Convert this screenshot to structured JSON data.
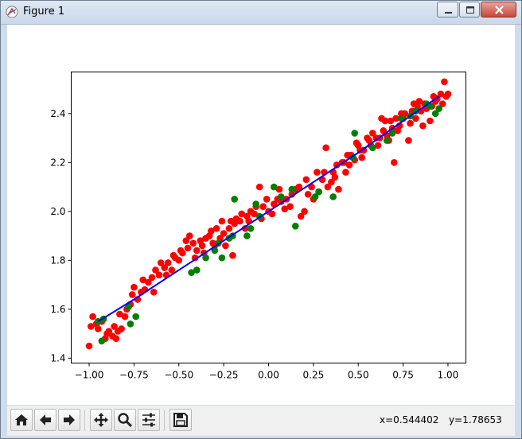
{
  "window": {
    "title": "Figure 1"
  },
  "toolbar": {
    "buttons": [
      {
        "name": "home-button",
        "icon": "home-icon"
      },
      {
        "name": "back-button",
        "icon": "arrow-left-icon"
      },
      {
        "name": "forward-button",
        "icon": "arrow-right-icon"
      },
      {
        "name": "pan-button",
        "icon": "move-icon"
      },
      {
        "name": "zoom-button",
        "icon": "magnifier-icon"
      },
      {
        "name": "subplots-button",
        "icon": "sliders-icon"
      },
      {
        "name": "save-button",
        "icon": "floppy-icon"
      }
    ],
    "coord_x": "x=0.544402",
    "coord_y": "y=1.78653"
  },
  "colors": {
    "train": "#ff0000",
    "test": "#008000",
    "fit": "#0000ff"
  },
  "chart_data": {
    "type": "scatter",
    "xlim": [
      -1.1,
      1.1
    ],
    "ylim": [
      1.38,
      2.57
    ],
    "xticks": [
      -1.0,
      -0.75,
      -0.5,
      -0.25,
      0.0,
      0.25,
      0.5,
      0.75,
      1.0
    ],
    "xtick_labels": [
      "−1.00",
      "−0.75",
      "−0.50",
      "−0.25",
      "0.00",
      "0.25",
      "0.50",
      "0.75",
      "1.00"
    ],
    "yticks": [
      1.4,
      1.6,
      1.8,
      2.0,
      2.2,
      2.4
    ],
    "ytick_labels": [
      "1.4",
      "1.6",
      "1.8",
      "2.0",
      "2.2",
      "2.4"
    ],
    "grid": false,
    "series": [
      {
        "color": "red",
        "points": [
          [
            -1.0,
            1.45
          ],
          [
            -0.99,
            1.53
          ],
          [
            -0.98,
            1.57
          ],
          [
            -0.96,
            1.54
          ],
          [
            -0.95,
            1.52
          ],
          [
            -0.93,
            1.55
          ],
          [
            -0.91,
            1.48
          ],
          [
            -0.9,
            1.5
          ],
          [
            -0.89,
            1.51
          ],
          [
            -0.87,
            1.49
          ],
          [
            -0.86,
            1.53
          ],
          [
            -0.85,
            1.48
          ],
          [
            -0.84,
            1.51
          ],
          [
            -0.83,
            1.58
          ],
          [
            -0.82,
            1.52
          ],
          [
            -0.8,
            1.57
          ],
          [
            -0.79,
            1.6
          ],
          [
            -0.77,
            1.62
          ],
          [
            -0.76,
            1.66
          ],
          [
            -0.75,
            1.69
          ],
          [
            -0.73,
            1.64
          ],
          [
            -0.71,
            1.67
          ],
          [
            -0.7,
            1.72
          ],
          [
            -0.69,
            1.68
          ],
          [
            -0.67,
            1.71
          ],
          [
            -0.65,
            1.73
          ],
          [
            -0.64,
            1.67
          ],
          [
            -0.63,
            1.76
          ],
          [
            -0.61,
            1.74
          ],
          [
            -0.6,
            1.79
          ],
          [
            -0.58,
            1.77
          ],
          [
            -0.57,
            1.74
          ],
          [
            -0.56,
            1.79
          ],
          [
            -0.54,
            1.76
          ],
          [
            -0.53,
            1.82
          ],
          [
            -0.52,
            1.81
          ],
          [
            -0.5,
            1.8
          ],
          [
            -0.49,
            1.84
          ],
          [
            -0.48,
            1.83
          ],
          [
            -0.46,
            1.88
          ],
          [
            -0.45,
            1.85
          ],
          [
            -0.44,
            1.9
          ],
          [
            -0.42,
            1.87
          ],
          [
            -0.41,
            1.81
          ],
          [
            -0.4,
            1.84
          ],
          [
            -0.38,
            1.88
          ],
          [
            -0.37,
            1.86
          ],
          [
            -0.36,
            1.83
          ],
          [
            -0.35,
            1.89
          ],
          [
            -0.33,
            1.9
          ],
          [
            -0.32,
            1.92
          ],
          [
            -0.31,
            1.87
          ],
          [
            -0.3,
            1.86
          ],
          [
            -0.29,
            1.93
          ],
          [
            -0.27,
            1.89
          ],
          [
            -0.26,
            1.96
          ],
          [
            -0.25,
            1.91
          ],
          [
            -0.24,
            1.86
          ],
          [
            -0.22,
            1.93
          ],
          [
            -0.21,
            1.96
          ],
          [
            -0.2,
            1.82
          ],
          [
            -0.19,
            1.95
          ],
          [
            -0.18,
            1.97
          ],
          [
            -0.16,
            1.96
          ],
          [
            -0.15,
            1.99
          ],
          [
            -0.13,
            1.93
          ],
          [
            -0.12,
            1.98
          ],
          [
            -0.11,
            1.96
          ],
          [
            -0.1,
            2.0
          ],
          [
            -0.08,
            1.99
          ],
          [
            -0.07,
            2.02
          ],
          [
            -0.05,
            2.1
          ],
          [
            -0.04,
            1.97
          ],
          [
            -0.03,
            2.02
          ],
          [
            -0.01,
            2.05
          ],
          [
            0.0,
            2.0
          ],
          [
            0.02,
            1.99
          ],
          [
            0.03,
            2.03
          ],
          [
            0.05,
            2.05
          ],
          [
            0.06,
            2.09
          ],
          [
            0.07,
            2.04
          ],
          [
            0.09,
            2.01
          ],
          [
            0.1,
            2.05
          ],
          [
            0.12,
            2.02
          ],
          [
            0.13,
            2.07
          ],
          [
            0.15,
            2.09
          ],
          [
            0.17,
            2.1
          ],
          [
            0.18,
            1.98
          ],
          [
            0.2,
            2.0
          ],
          [
            0.21,
            2.13
          ],
          [
            0.22,
            2.07
          ],
          [
            0.24,
            2.1
          ],
          [
            0.25,
            2.05
          ],
          [
            0.27,
            2.16
          ],
          [
            0.28,
            2.08
          ],
          [
            0.3,
            2.13
          ],
          [
            0.31,
            2.16
          ],
          [
            0.32,
            2.26
          ],
          [
            0.33,
            2.1
          ],
          [
            0.35,
            2.12
          ],
          [
            0.36,
            2.16
          ],
          [
            0.37,
            2.14
          ],
          [
            0.38,
            2.19
          ],
          [
            0.39,
            2.09
          ],
          [
            0.41,
            2.2
          ],
          [
            0.42,
            2.2
          ],
          [
            0.43,
            2.16
          ],
          [
            0.44,
            2.23
          ],
          [
            0.45,
            2.19
          ],
          [
            0.46,
            2.23
          ],
          [
            0.48,
            2.21
          ],
          [
            0.49,
            2.28
          ],
          [
            0.5,
            2.27
          ],
          [
            0.51,
            2.25
          ],
          [
            0.52,
            2.22
          ],
          [
            0.53,
            2.25
          ],
          [
            0.55,
            2.3
          ],
          [
            0.56,
            2.29
          ],
          [
            0.57,
            2.27
          ],
          [
            0.58,
            2.32
          ],
          [
            0.6,
            2.3
          ],
          [
            0.61,
            2.27
          ],
          [
            0.62,
            2.3
          ],
          [
            0.63,
            2.38
          ],
          [
            0.64,
            2.33
          ],
          [
            0.65,
            2.37
          ],
          [
            0.66,
            2.31
          ],
          [
            0.67,
            2.29
          ],
          [
            0.68,
            2.37
          ],
          [
            0.69,
            2.34
          ],
          [
            0.7,
            2.2
          ],
          [
            0.71,
            2.38
          ],
          [
            0.72,
            2.33
          ],
          [
            0.73,
            2.35
          ],
          [
            0.74,
            2.4
          ],
          [
            0.75,
            2.38
          ],
          [
            0.76,
            2.4
          ],
          [
            0.78,
            2.29
          ],
          [
            0.79,
            2.36
          ],
          [
            0.8,
            2.41
          ],
          [
            0.81,
            2.44
          ],
          [
            0.82,
            2.38
          ],
          [
            0.83,
            2.43
          ],
          [
            0.84,
            2.45
          ],
          [
            0.85,
            2.41
          ],
          [
            0.86,
            2.35
          ],
          [
            0.87,
            2.44
          ],
          [
            0.88,
            2.42
          ],
          [
            0.9,
            2.37
          ],
          [
            0.91,
            2.43
          ],
          [
            0.92,
            2.47
          ],
          [
            0.93,
            2.45
          ],
          [
            0.94,
            2.46
          ],
          [
            0.96,
            2.48
          ],
          [
            0.97,
            2.44
          ],
          [
            0.98,
            2.53
          ],
          [
            0.99,
            2.47
          ],
          [
            1.0,
            2.48
          ]
        ]
      },
      {
        "color": "green",
        "points": [
          [
            -0.95,
            1.55
          ],
          [
            -0.93,
            1.47
          ],
          [
            -0.92,
            1.56
          ],
          [
            -0.78,
            1.61
          ],
          [
            -0.77,
            1.54
          ],
          [
            -0.74,
            1.57
          ],
          [
            -0.43,
            1.75
          ],
          [
            -0.4,
            1.76
          ],
          [
            -0.35,
            1.81
          ],
          [
            -0.3,
            1.84
          ],
          [
            -0.28,
            1.87
          ],
          [
            -0.26,
            1.81
          ],
          [
            -0.22,
            1.89
          ],
          [
            -0.2,
            1.9
          ],
          [
            -0.19,
            2.05
          ],
          [
            -0.12,
            1.9
          ],
          [
            -0.1,
            1.93
          ],
          [
            -0.07,
            2.03
          ],
          [
            -0.05,
            1.98
          ],
          [
            0.03,
            2.1
          ],
          [
            0.07,
            2.06
          ],
          [
            0.13,
            2.09
          ],
          [
            0.15,
            1.94
          ],
          [
            0.26,
            2.06
          ],
          [
            0.28,
            2.08
          ],
          [
            0.36,
            2.06
          ],
          [
            0.47,
            2.22
          ],
          [
            0.48,
            2.32
          ],
          [
            0.58,
            2.26
          ],
          [
            0.66,
            2.29
          ],
          [
            0.69,
            2.32
          ],
          [
            0.74,
            2.38
          ],
          [
            0.79,
            2.39
          ],
          [
            0.82,
            2.41
          ],
          [
            0.88,
            2.44
          ],
          [
            0.9,
            2.43
          ],
          [
            0.93,
            2.4
          ],
          [
            0.95,
            2.42
          ]
        ]
      },
      {
        "color": "blue",
        "kind": "line",
        "points": [
          [
            -0.95,
            1.55
          ],
          [
            -0.75,
            1.64
          ],
          [
            -0.5,
            1.76
          ],
          [
            -0.25,
            1.88
          ],
          [
            0.0,
            2.0
          ],
          [
            0.25,
            2.12
          ],
          [
            0.5,
            2.24
          ],
          [
            0.75,
            2.37
          ],
          [
            0.95,
            2.47
          ]
        ]
      }
    ]
  }
}
